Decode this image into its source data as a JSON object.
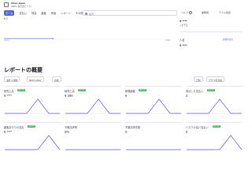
{
  "app": {
    "account_title": "Stripe Japan",
    "account_sub": "DEMO 株式会社 テスト",
    "search_placeholder": "検索"
  },
  "nav": [
    "ホーム",
    "支払い",
    "残高",
    "顧客",
    "商品",
    "レポート",
    "その他"
  ],
  "topbar_right": {
    "help": "ヘルプ",
    "developers": "開発者",
    "test_mode": "テスト環境"
  },
  "main_chart": {
    "value": "¥ 0",
    "x_start": "00:00",
    "x_end": "23:59"
  },
  "side": {
    "balance_label": "¥ ****",
    "balance_sub": "入金予定",
    "payouts_label": "入金",
    "payouts_link": "詳細を表示",
    "payouts_value": "¥ ****"
  },
  "overview": {
    "title": "レポートの概要",
    "filter_period": "過去 4 週間",
    "filter_range": "05/07–05/27",
    "filter_compare": "比較",
    "filter_daily": "日別",
    "add_button": "グラフを追加"
  },
  "cards": [
    {
      "title": "総売上高",
      "badge": "100.0%",
      "value": "¥ ****"
    },
    {
      "title": "純売上高",
      "badge": "100.0%",
      "value": "¥ 290"
    },
    {
      "title": "新規顧客",
      "badge": "100.0%",
      "value": "6"
    },
    {
      "title": "成功した支払い",
      "badge": "100.0%",
      "value": "2"
    },
    {
      "title": "顧客あたりの支出",
      "badge": "100.0%",
      "value": "¥ ****"
    },
    {
      "title": "不審請求率",
      "badge": "",
      "value": "0%"
    },
    {
      "title": "不審請求件数",
      "badge": "",
      "value": "0"
    },
    {
      "title": "リスクの高い支払い",
      "badge": "100.0%",
      "value": "0"
    }
  ],
  "colors": {
    "accent": "#5469d4",
    "badge": "#3fb553",
    "line": "#625afa"
  },
  "chart_data": [
    {
      "type": "line",
      "series": [
        {
          "values": [
            0,
            0,
            0,
            1,
            0,
            0
          ]
        }
      ]
    },
    {
      "type": "line",
      "series": [
        {
          "values": [
            0,
            0,
            0,
            1,
            0,
            0
          ]
        }
      ]
    },
    {
      "type": "line",
      "series": [
        {
          "values": [
            0,
            0,
            0,
            1,
            0,
            0
          ]
        }
      ]
    },
    {
      "type": "line",
      "series": [
        {
          "values": [
            0,
            0,
            0,
            1,
            0,
            0
          ]
        }
      ]
    },
    {
      "type": "line",
      "series": [
        {
          "values": [
            0,
            0,
            0,
            0,
            1,
            0
          ]
        }
      ]
    },
    {
      "type": "line",
      "series": [
        {
          "values": [
            0,
            0,
            0,
            0,
            0,
            0
          ]
        }
      ]
    },
    {
      "type": "line",
      "series": [
        {
          "values": [
            0,
            0,
            0,
            0,
            0,
            0
          ]
        }
      ]
    },
    {
      "type": "line",
      "series": [
        {
          "values": [
            0,
            0,
            0,
            0,
            1,
            0
          ]
        }
      ]
    }
  ]
}
